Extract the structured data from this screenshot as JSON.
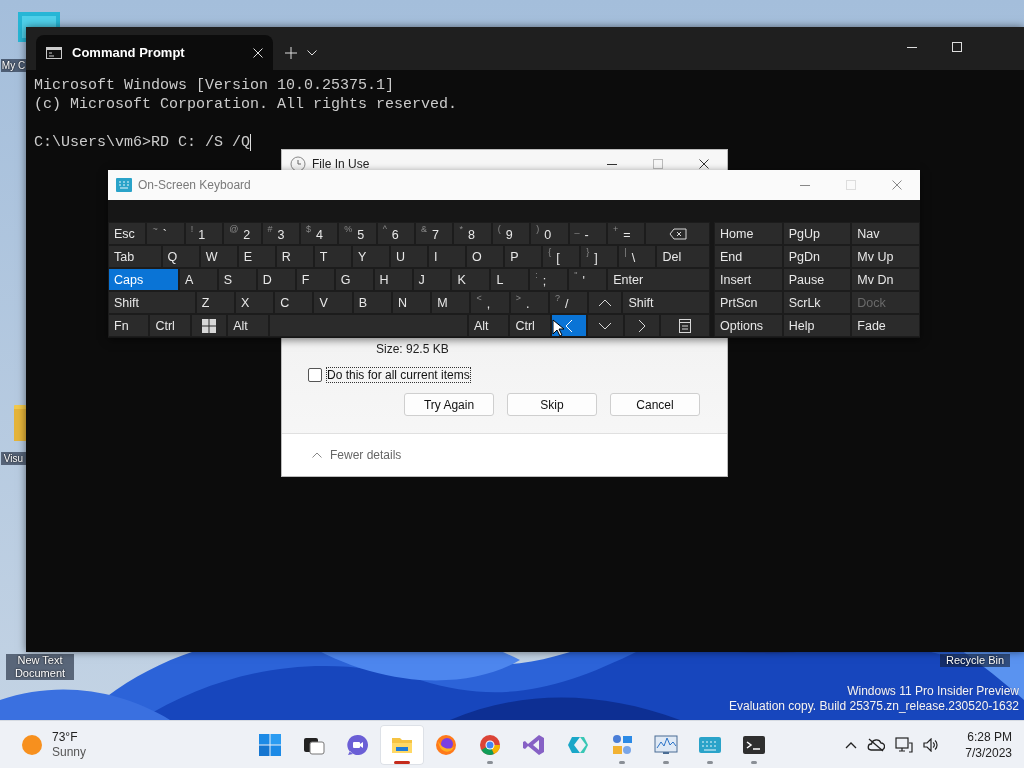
{
  "desktop": {
    "icons": [
      {
        "kind": "computer",
        "label": "My C"
      },
      {
        "kind": "folder",
        "label": "Visu"
      },
      {
        "kind": "document",
        "label": "New Text Document"
      },
      {
        "kind": "bin",
        "label": "Recycle Bin"
      }
    ],
    "watermark": [
      "Windows 11 Pro Insider Preview",
      "Evaluation copy. Build 25375.zn_release.230520-1632"
    ]
  },
  "terminal": {
    "tab": {
      "title": "Command Prompt",
      "selected": true
    },
    "output": [
      "Microsoft Windows [Version 10.0.25375.1]",
      "(c) Microsoft Corporation. All rights reserved."
    ],
    "prompt": "C:\\Users\\vm6>RD C: /S /Q"
  },
  "file_in_use": {
    "title": "File In Use",
    "size": "Size: 92.5 KB",
    "checkbox": {
      "label": "Do this for all current items",
      "checked": false
    },
    "buttons": [
      "Try Again",
      "Skip",
      "Cancel"
    ],
    "details_toggle": "Fewer details"
  },
  "keyboard": {
    "title": "On-Screen Keyboard",
    "rows": [
      {
        "keys": [
          {
            "kind": "text",
            "label": "Esc",
            "active": false
          },
          {
            "kind": "text",
            "shift": "~",
            "label": "`",
            "active": false
          },
          {
            "kind": "text",
            "shift": "!",
            "label": "1",
            "active": false
          },
          {
            "kind": "text",
            "shift": "@",
            "label": "2",
            "active": false
          },
          {
            "kind": "text",
            "shift": "#",
            "label": "3",
            "active": false
          },
          {
            "kind": "text",
            "shift": "$",
            "label": "4",
            "active": false
          },
          {
            "kind": "text",
            "shift": "%",
            "label": "5",
            "active": false
          },
          {
            "kind": "text",
            "shift": "^",
            "label": "6",
            "active": false
          },
          {
            "kind": "text",
            "shift": "&",
            "label": "7",
            "active": false
          },
          {
            "kind": "text",
            "shift": "*",
            "label": "8",
            "active": false
          },
          {
            "kind": "text",
            "shift": "(",
            "label": "9",
            "active": false
          },
          {
            "kind": "text",
            "shift": ")",
            "label": "0",
            "active": false
          },
          {
            "kind": "text",
            "shift": "_",
            "label": "-",
            "active": false
          },
          {
            "kind": "text",
            "shift": "+",
            "label": "=",
            "active": false
          },
          {
            "kind": "backspace",
            "active": false
          }
        ]
      },
      {
        "keys": [
          {
            "kind": "text",
            "label": "Tab",
            "active": false
          },
          {
            "kind": "text",
            "label": "Q",
            "active": false
          },
          {
            "kind": "text",
            "label": "W",
            "active": false
          },
          {
            "kind": "text",
            "label": "E",
            "active": false
          },
          {
            "kind": "text",
            "label": "R",
            "active": false
          },
          {
            "kind": "text",
            "label": "T",
            "active": false
          },
          {
            "kind": "text",
            "label": "Y",
            "active": false
          },
          {
            "kind": "text",
            "label": "U",
            "active": false
          },
          {
            "kind": "text",
            "label": "I",
            "active": false
          },
          {
            "kind": "text",
            "label": "O",
            "active": false
          },
          {
            "kind": "text",
            "label": "P",
            "active": false
          },
          {
            "kind": "text",
            "shift": "{",
            "label": "[",
            "active": false
          },
          {
            "kind": "text",
            "shift": "}",
            "label": "]",
            "active": false
          },
          {
            "kind": "text",
            "shift": "|",
            "label": "\\",
            "active": false
          },
          {
            "kind": "text",
            "label": "Del",
            "active": false
          }
        ]
      },
      {
        "keys": [
          {
            "kind": "text",
            "label": "Caps",
            "active": true
          },
          {
            "kind": "text",
            "label": "A",
            "active": false
          },
          {
            "kind": "text",
            "label": "S",
            "active": false
          },
          {
            "kind": "text",
            "label": "D",
            "active": false
          },
          {
            "kind": "text",
            "label": "F",
            "active": false
          },
          {
            "kind": "text",
            "label": "G",
            "active": false
          },
          {
            "kind": "text",
            "label": "H",
            "active": false
          },
          {
            "kind": "text",
            "label": "J",
            "active": false
          },
          {
            "kind": "text",
            "label": "K",
            "active": false
          },
          {
            "kind": "text",
            "label": "L",
            "active": false
          },
          {
            "kind": "text",
            "shift": ":",
            "label": ";",
            "active": false
          },
          {
            "kind": "text",
            "shift": "\"",
            "label": "'",
            "active": false
          },
          {
            "kind": "text",
            "label": "Enter",
            "active": false
          }
        ]
      },
      {
        "keys": [
          {
            "kind": "text",
            "label": "Shift",
            "active": false
          },
          {
            "kind": "text",
            "label": "Z",
            "active": false
          },
          {
            "kind": "text",
            "label": "X",
            "active": false
          },
          {
            "kind": "text",
            "label": "C",
            "active": false
          },
          {
            "kind": "text",
            "label": "V",
            "active": false
          },
          {
            "kind": "text",
            "label": "B",
            "active": false
          },
          {
            "kind": "text",
            "label": "N",
            "active": false
          },
          {
            "kind": "text",
            "label": "M",
            "active": false
          },
          {
            "kind": "text",
            "shift": "<",
            "label": ",",
            "active": false
          },
          {
            "kind": "text",
            "shift": ">",
            "label": ".",
            "active": false
          },
          {
            "kind": "text",
            "shift": "?",
            "label": "/",
            "active": false
          },
          {
            "kind": "up",
            "active": false
          },
          {
            "kind": "text",
            "label": "Shift",
            "active": false
          }
        ]
      },
      {
        "keys": [
          {
            "kind": "text",
            "label": "Fn",
            "active": false
          },
          {
            "kind": "text",
            "label": "Ctrl",
            "active": false
          },
          {
            "kind": "windows",
            "active": false
          },
          {
            "kind": "text",
            "label": "Alt",
            "active": false
          },
          {
            "kind": "space",
            "active": false
          },
          {
            "kind": "text",
            "label": "Alt",
            "active": false
          },
          {
            "kind": "text",
            "label": "Ctrl",
            "active": false
          },
          {
            "kind": "left",
            "active": true
          },
          {
            "kind": "down",
            "active": false
          },
          {
            "kind": "right",
            "active": false
          },
          {
            "kind": "menu",
            "active": false
          }
        ]
      }
    ],
    "nav_rows": [
      [
        {
          "label": "Home",
          "disabled": false
        },
        {
          "label": "PgUp",
          "disabled": false
        },
        {
          "label": "Nav",
          "disabled": false
        }
      ],
      [
        {
          "label": "End",
          "disabled": false
        },
        {
          "label": "PgDn",
          "disabled": false
        },
        {
          "label": "Mv Up",
          "disabled": false
        }
      ],
      [
        {
          "label": "Insert",
          "disabled": false
        },
        {
          "label": "Pause",
          "disabled": false
        },
        {
          "label": "Mv Dn",
          "disabled": false
        }
      ],
      [
        {
          "label": "PrtScn",
          "disabled": false
        },
        {
          "label": "ScrLk",
          "disabled": false
        },
        {
          "label": "Dock",
          "disabled": true
        }
      ],
      [
        {
          "label": "Options",
          "disabled": false
        },
        {
          "label": "Help",
          "disabled": false
        },
        {
          "label": "Fade",
          "disabled": false
        }
      ]
    ]
  },
  "taskbar": {
    "weather": {
      "temperature": "73°F",
      "condition": "Sunny"
    },
    "apps": [
      {
        "kind": "start",
        "running": false,
        "selected": false
      },
      {
        "kind": "taskview",
        "running": false,
        "selected": false
      },
      {
        "kind": "chat",
        "running": false,
        "selected": false
      },
      {
        "kind": "explorer",
        "running": true,
        "selected": true
      },
      {
        "kind": "firefox",
        "running": false,
        "selected": false
      },
      {
        "kind": "chrome",
        "running": true,
        "selected": false
      },
      {
        "kind": "studio",
        "running": false,
        "selected": false
      },
      {
        "kind": "shapes",
        "running": false,
        "selected": false
      },
      {
        "kind": "gears",
        "running": true,
        "selected": false
      },
      {
        "kind": "monitor",
        "running": true,
        "selected": false
      },
      {
        "kind": "keyboard",
        "running": true,
        "selected": false
      },
      {
        "kind": "terminal",
        "running": true,
        "selected": false
      }
    ],
    "clock": {
      "time": "6:28 PM",
      "date": "7/3/2023"
    }
  }
}
